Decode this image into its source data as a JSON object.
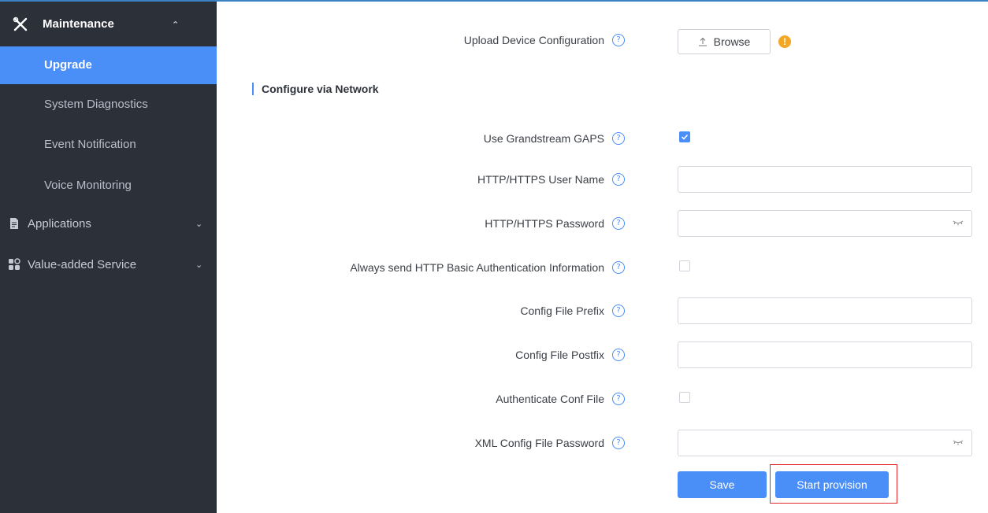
{
  "sidebar": {
    "section": {
      "label": "Maintenance",
      "icon": "tools-icon"
    },
    "active_item": "Upgrade",
    "sub_items": [
      "System Diagnostics",
      "Event Notification",
      "Voice Monitoring"
    ],
    "top_items": [
      {
        "label": "Applications",
        "icon": "document-icon"
      },
      {
        "label": "Value-added Service",
        "icon": "grid-icon"
      }
    ]
  },
  "main": {
    "upload": {
      "label": "Upload Device Configuration",
      "button": "Browse",
      "icon": "upload-icon",
      "warning_icon": "warning-icon"
    },
    "section_title": "Configure via Network",
    "fields": {
      "gaps": {
        "label": "Use Grandstream GAPS",
        "checked": true
      },
      "user": {
        "label": "HTTP/HTTPS User Name",
        "value": ""
      },
      "password": {
        "label": "HTTP/HTTPS Password",
        "value": ""
      },
      "basic_auth": {
        "label": "Always send HTTP Basic Authentication Information",
        "checked": false
      },
      "prefix": {
        "label": "Config File Prefix",
        "value": ""
      },
      "postfix": {
        "label": "Config File Postfix",
        "value": ""
      },
      "auth_conf": {
        "label": "Authenticate Conf File",
        "checked": false
      },
      "xml_password": {
        "label": "XML Config File Password",
        "value": ""
      }
    },
    "help_glyph": "?",
    "warning_glyph": "!",
    "buttons": {
      "save": "Save",
      "start_provision": "Start provision"
    }
  },
  "colors": {
    "accent": "#4a8ef7",
    "sidebar_bg": "#2b3039",
    "highlight": "#e0282e",
    "warning": "#f5a623"
  }
}
